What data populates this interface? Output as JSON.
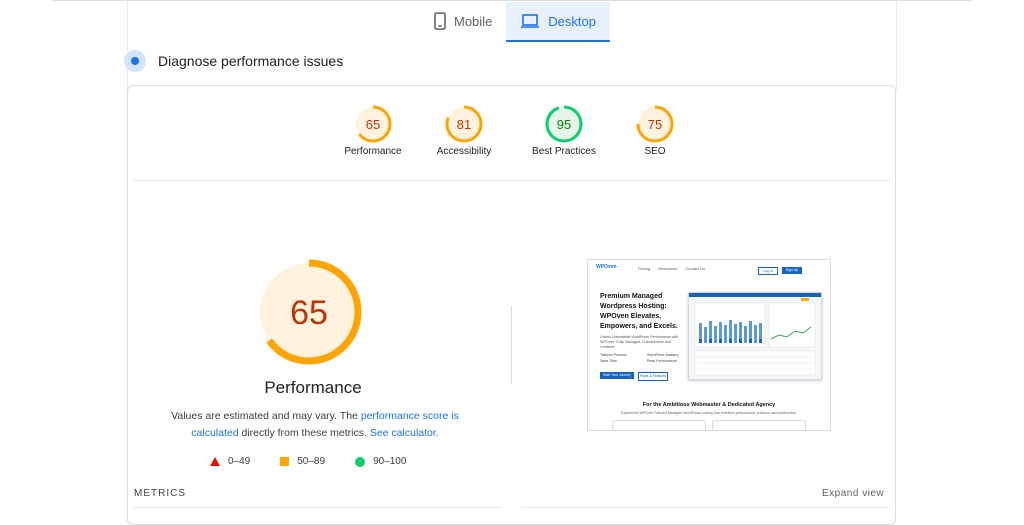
{
  "tabs": [
    {
      "label": "Mobile",
      "icon": "phone-icon",
      "active": false
    },
    {
      "label": "Desktop",
      "icon": "laptop-icon",
      "active": true
    }
  ],
  "section_title": "Diagnose performance issues",
  "colors": {
    "fail": "#eb0f00",
    "average": "#ffa400",
    "pass": "#0cce6b",
    "accent": "#1a73e8"
  },
  "categories": [
    {
      "label": "Performance",
      "score": "65",
      "status": "average"
    },
    {
      "label": "Accessibility",
      "score": "81",
      "status": "average"
    },
    {
      "label": "Best Practices",
      "score": "95",
      "status": "pass"
    },
    {
      "label": "SEO",
      "score": "75",
      "status": "average"
    }
  ],
  "main": {
    "score": "65",
    "title": "Performance",
    "note_prefix": "Values are estimated and may vary. The ",
    "note_link1": "performance score is calculated",
    "note_middle": " directly from these metrics. ",
    "note_link2": "See calculator."
  },
  "legend": {
    "fail": "0–49",
    "average": "50–89",
    "pass": "90–100"
  },
  "metrics": {
    "title": "METRICS",
    "expand": "Expand view"
  },
  "screenshot": {
    "logo": "WPOven",
    "nav": [
      "Pricing",
      "Resources",
      "Contact Us"
    ],
    "login": "Log in",
    "signup": "Sign Up",
    "headline": "Premium Managed Wordpress Hosting: WPOven Elevates, Empowers, and Excels.",
    "paragraph": "Unlock Unbeatable WordPress Performance with WPOven: Fully Managed, Customizable and Limitless!",
    "features": [
      "Tailored Process",
      "WordPress Mastery",
      "Save Time",
      "Peak Performance"
    ],
    "cta_primary": "Start Your Journey",
    "cta_secondary": "Plans & Features",
    "footer_heading": "For the Ambitious Webmaster & Dedicated Agency",
    "footer_sub": "Experience WPOven Tailored Managed WordPress hosting that redefines performance precision and partnership."
  }
}
